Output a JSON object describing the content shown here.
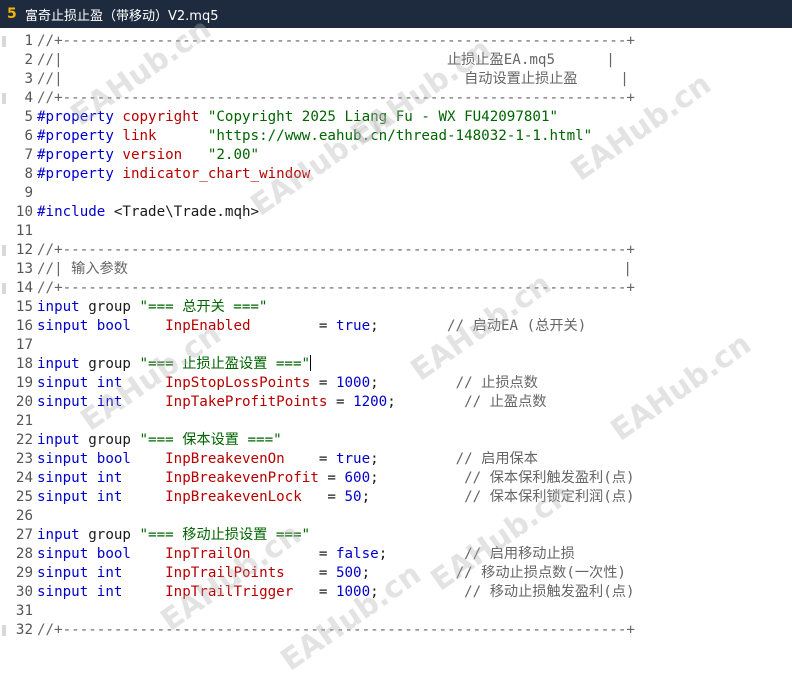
{
  "tab": {
    "number": "5",
    "title": "富奇止损止盈（带移动）V2.mq5"
  },
  "watermark_text": "EAHub.cn",
  "lines": [
    {
      "n": "1",
      "segs": [
        [
          "cmt",
          "//+------------------------------------------------------------------+"
        ]
      ]
    },
    {
      "n": "2",
      "segs": [
        [
          "cmt",
          "//|                                             止损止盈EA.mq5      |"
        ]
      ]
    },
    {
      "n": "3",
      "segs": [
        [
          "cmt",
          "//|                                               自动设置止损止盈     |"
        ]
      ]
    },
    {
      "n": "4",
      "segs": [
        [
          "cmt",
          "//+------------------------------------------------------------------+"
        ]
      ]
    },
    {
      "n": "5",
      "segs": [
        [
          "kw-pp",
          "#property "
        ],
        [
          "kw-red",
          "copyright "
        ],
        [
          "kw-str",
          "\"Copyright 2025 Liang Fu - WX FU42097801\""
        ]
      ]
    },
    {
      "n": "6",
      "segs": [
        [
          "kw-pp",
          "#property "
        ],
        [
          "kw-red",
          "link      "
        ],
        [
          "kw-str",
          "\"https://www.eahub.cn/thread-148032-1-1.html\""
        ]
      ]
    },
    {
      "n": "7",
      "segs": [
        [
          "kw-pp",
          "#property "
        ],
        [
          "kw-red",
          "version   "
        ],
        [
          "kw-str",
          "\"2.00\""
        ]
      ]
    },
    {
      "n": "8",
      "segs": [
        [
          "kw-pp",
          "#property "
        ],
        [
          "kw-red",
          "indicator_chart_window"
        ]
      ]
    },
    {
      "n": "9",
      "segs": []
    },
    {
      "n": "10",
      "segs": [
        [
          "kw-pp",
          "#include "
        ],
        [
          "txt",
          "<Trade\\Trade.mqh>"
        ]
      ]
    },
    {
      "n": "11",
      "segs": []
    },
    {
      "n": "12",
      "segs": [
        [
          "cmt",
          "//+------------------------------------------------------------------+"
        ]
      ]
    },
    {
      "n": "13",
      "segs": [
        [
          "cmt",
          "//| 输入参数                                                          |"
        ]
      ]
    },
    {
      "n": "14",
      "segs": [
        [
          "cmt",
          "//+------------------------------------------------------------------+"
        ]
      ]
    },
    {
      "n": "15",
      "segs": [
        [
          "kw-blue",
          "input "
        ],
        [
          "txt",
          "group "
        ],
        [
          "kw-str",
          "\"=== 总开关 ===\""
        ]
      ]
    },
    {
      "n": "16",
      "segs": [
        [
          "kw-blue",
          "sinput bool    "
        ],
        [
          "kw-red",
          "InpEnabled        "
        ],
        [
          "txt",
          "= "
        ],
        [
          "kw-blue",
          "true"
        ],
        [
          "txt",
          ";        "
        ],
        [
          "cmt",
          "// 启动EA (总开关)"
        ]
      ]
    },
    {
      "n": "17",
      "segs": []
    },
    {
      "n": "18",
      "segs": [
        [
          "kw-blue",
          "input "
        ],
        [
          "txt",
          "group "
        ],
        [
          "kw-str",
          "\"=== 止损止盈设置 ===\""
        ],
        [
          "caret",
          ""
        ]
      ]
    },
    {
      "n": "19",
      "segs": [
        [
          "kw-blue",
          "sinput int     "
        ],
        [
          "kw-red",
          "InpStopLossPoints "
        ],
        [
          "txt",
          "= "
        ],
        [
          "kw-num",
          "1000"
        ],
        [
          "txt",
          ";         "
        ],
        [
          "cmt",
          "// 止损点数"
        ]
      ]
    },
    {
      "n": "20",
      "segs": [
        [
          "kw-blue",
          "sinput int     "
        ],
        [
          "kw-red",
          "InpTakeProfitPoints "
        ],
        [
          "txt",
          "= "
        ],
        [
          "kw-num",
          "1200"
        ],
        [
          "txt",
          ";        "
        ],
        [
          "cmt",
          "// 止盈点数"
        ]
      ]
    },
    {
      "n": "21",
      "segs": []
    },
    {
      "n": "22",
      "segs": [
        [
          "kw-blue",
          "input "
        ],
        [
          "txt",
          "group "
        ],
        [
          "kw-str",
          "\"=== 保本设置 ===\""
        ]
      ]
    },
    {
      "n": "23",
      "segs": [
        [
          "kw-blue",
          "sinput bool    "
        ],
        [
          "kw-red",
          "InpBreakevenOn    "
        ],
        [
          "txt",
          "= "
        ],
        [
          "kw-blue",
          "true"
        ],
        [
          "txt",
          ";         "
        ],
        [
          "cmt",
          "// 启用保本"
        ]
      ]
    },
    {
      "n": "24",
      "segs": [
        [
          "kw-blue",
          "sinput int     "
        ],
        [
          "kw-red",
          "InpBreakevenProfit "
        ],
        [
          "txt",
          "= "
        ],
        [
          "kw-num",
          "600"
        ],
        [
          "txt",
          ";          "
        ],
        [
          "cmt",
          "// 保本保利触发盈利(点)"
        ]
      ]
    },
    {
      "n": "25",
      "segs": [
        [
          "kw-blue",
          "sinput int     "
        ],
        [
          "kw-red",
          "InpBreakevenLock   "
        ],
        [
          "txt",
          "= "
        ],
        [
          "kw-num",
          "50"
        ],
        [
          "txt",
          ";           "
        ],
        [
          "cmt",
          "// 保本保利锁定利润(点)"
        ]
      ]
    },
    {
      "n": "26",
      "segs": []
    },
    {
      "n": "27",
      "segs": [
        [
          "kw-blue",
          "input "
        ],
        [
          "txt",
          "group "
        ],
        [
          "kw-str",
          "\"=== 移动止损设置 ===\""
        ]
      ]
    },
    {
      "n": "28",
      "segs": [
        [
          "kw-blue",
          "sinput bool    "
        ],
        [
          "kw-red",
          "InpTrailOn        "
        ],
        [
          "txt",
          "= "
        ],
        [
          "kw-blue",
          "false"
        ],
        [
          "txt",
          ";         "
        ],
        [
          "cmt",
          "// 启用移动止损"
        ]
      ]
    },
    {
      "n": "29",
      "segs": [
        [
          "kw-blue",
          "sinput int     "
        ],
        [
          "kw-red",
          "InpTrailPoints    "
        ],
        [
          "txt",
          "= "
        ],
        [
          "kw-num",
          "500"
        ],
        [
          "txt",
          ";          "
        ],
        [
          "cmt",
          "// 移动止损点数(一次性)"
        ]
      ]
    },
    {
      "n": "30",
      "segs": [
        [
          "kw-blue",
          "sinput int     "
        ],
        [
          "kw-red",
          "InpTrailTrigger   "
        ],
        [
          "txt",
          "= "
        ],
        [
          "kw-num",
          "1000"
        ],
        [
          "txt",
          ";          "
        ],
        [
          "cmt",
          "// 移动止损触发盈利(点)"
        ]
      ]
    },
    {
      "n": "31",
      "segs": []
    },
    {
      "n": "32",
      "segs": [
        [
          "cmt",
          "//+------------------------------------------------------------------+"
        ]
      ]
    }
  ]
}
